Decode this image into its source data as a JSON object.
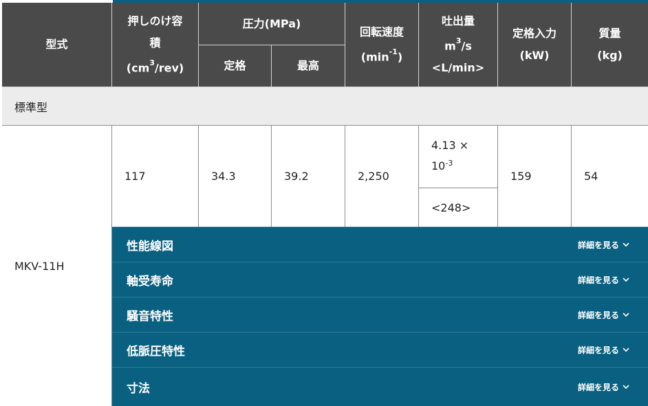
{
  "header": {
    "model": "型式",
    "displacement_line1": "押しのけ容",
    "displacement_line2": "積",
    "displacement_unit_pre": "(cm",
    "displacement_unit_sup": "3",
    "displacement_unit_post": "/rev)",
    "pressure": "圧力(MPa)",
    "pressure_rated": "定格",
    "pressure_max": "最高",
    "speed": "回転速度",
    "speed_unit_pre": "(min",
    "speed_unit_sup": "-1",
    "speed_unit_post": ")",
    "discharge": "吐出量",
    "discharge_unit1_pre": "m",
    "discharge_unit1_sup": "3",
    "discharge_unit1_post": "/s",
    "discharge_unit2": "<L/min>",
    "power_line1": "定格入力",
    "power_line2": "(kW)",
    "mass_line1": "質量",
    "mass_line2": "(kg)"
  },
  "section_label": "標準型",
  "row": {
    "model": "MKV-11H",
    "displacement": "117",
    "pressure_rated": "34.3",
    "pressure_max": "39.2",
    "speed": "2,250",
    "discharge_m3s_pre": "4.13 ×",
    "discharge_m3s_exp_base": "10",
    "discharge_m3s_exp": "-3",
    "discharge_lmin": "<248>",
    "power": "159",
    "mass": "54"
  },
  "accordions": [
    {
      "title": "性能線図",
      "more": "詳細を見る"
    },
    {
      "title": "軸受寿命",
      "more": "詳細を見る"
    },
    {
      "title": "騒音特性",
      "more": "詳細を見る"
    },
    {
      "title": "低脈圧特性",
      "more": "詳細を見る"
    },
    {
      "title": "寸法",
      "more": "詳細を見る"
    }
  ],
  "colors": {
    "header_bg": "#4a4a4a",
    "accent": "#0a6080",
    "section_bg": "#ececec"
  }
}
